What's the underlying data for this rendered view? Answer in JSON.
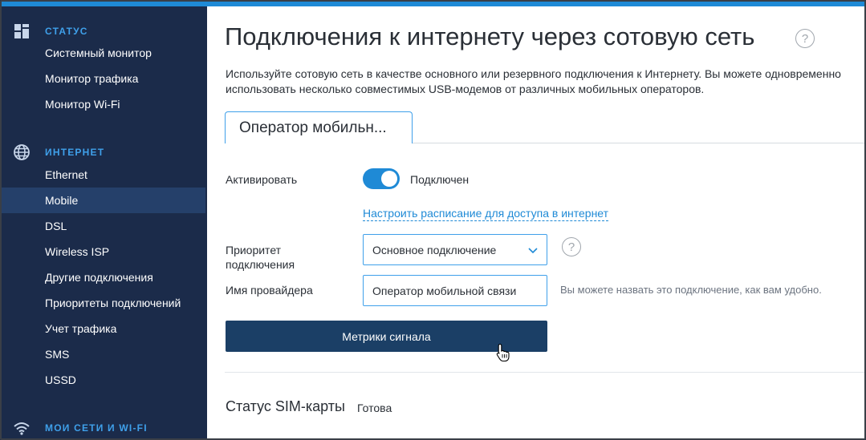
{
  "sidebar": {
    "sections": [
      {
        "title": "СТАТУС",
        "icon": "dashboard-grid-icon",
        "items": [
          "Системный монитор",
          "Монитор трафика",
          "Монитор Wi-Fi"
        ]
      },
      {
        "title": "ИНТЕРНЕТ",
        "icon": "globe-icon",
        "items": [
          "Ethernet",
          "Mobile",
          "DSL",
          "Wireless ISP",
          "Другие подключения",
          "Приоритеты подключений",
          "Учет трафика",
          "SMS",
          "USSD"
        ]
      },
      {
        "title": "МОИ СЕТИ И WI-FI",
        "icon": "wifi-icon",
        "items": []
      }
    ],
    "active_item": "Mobile"
  },
  "main": {
    "title": "Подключения к интернету через сотовую сеть",
    "help_icon": "question-circle-icon",
    "description": "Используйте сотовую сеть в качестве основного или резервного подключения к Интернету. Вы можете одновременно использовать несколько совместимых USB-модемов от различных мобильных операторов.",
    "tab_label": "Оператор мобильн...",
    "activate": {
      "label": "Активировать",
      "state": "Подключен",
      "enabled": true
    },
    "schedule_link": "Настроить расписание для доступа в интернет",
    "priority": {
      "label": "Приоритет подключения",
      "value": "Основное подключение"
    },
    "provider": {
      "label": "Имя провайдера",
      "value": "Оператор мобильной связи",
      "hint": "Вы можете назвать это подключение, как вам удобно."
    },
    "signal_button": "Метрики сигнала",
    "sim": {
      "label": "Статус SIM-карты",
      "value": "Готова"
    }
  },
  "colors": {
    "sidebar_bg": "#1b2b4a",
    "sidebar_active": "#25406a",
    "accent": "#1f8ad6",
    "button_bg": "#1b3f66"
  }
}
